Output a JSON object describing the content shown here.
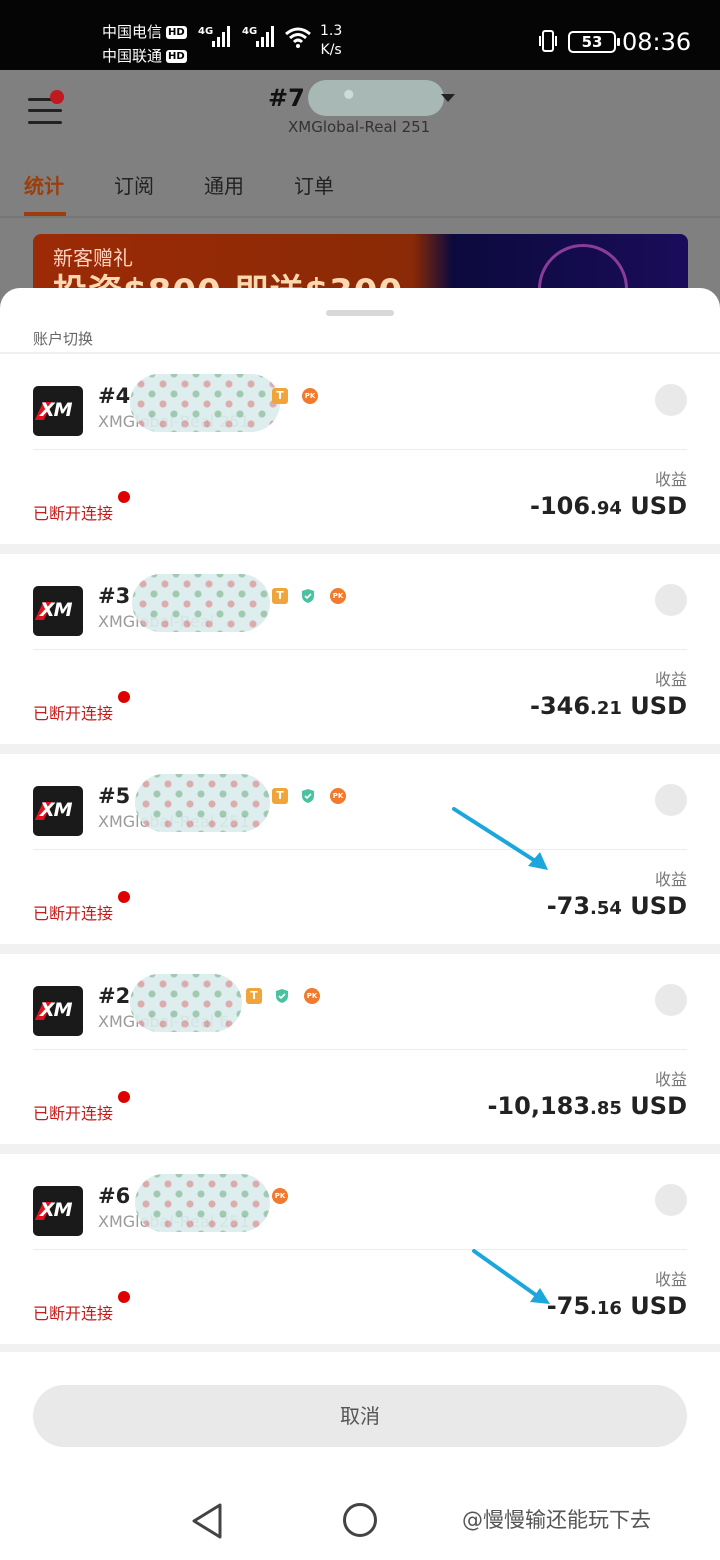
{
  "status_bar": {
    "carrier1": "中国电信",
    "carrier2": "中国联通",
    "hd_label": "HD",
    "net1": "4G",
    "net2": "4G",
    "speed_value": "1.3",
    "speed_unit": "K/s",
    "battery": "53",
    "time": "08:36"
  },
  "header": {
    "account_number": "#7",
    "server": "XMGlobal-Real 251"
  },
  "tabs": [
    "统计",
    "订阅",
    "通用",
    "订单"
  ],
  "banner": {
    "title": "新客赠礼",
    "headline": "投资$800 即送$300"
  },
  "sheet": {
    "title": "账户切换",
    "profit_label": "收益",
    "status_label": "已断开连接",
    "cancel_label": "取消"
  },
  "accounts": [
    {
      "number": "#4",
      "server": "XMGlobal-Real 251",
      "profit_int": "-106",
      "profit_dec": ".94",
      "currency": "USD",
      "badges": [
        "T",
        "PK"
      ]
    },
    {
      "number": "#3",
      "server": "XMGlobal-Real",
      "profit_int": "-346",
      "profit_dec": ".21",
      "currency": "USD",
      "badges": [
        "T",
        "shield",
        "PK"
      ]
    },
    {
      "number": "#5",
      "server": "XMGlobal-Real 251",
      "profit_int": "-73",
      "profit_dec": ".54",
      "currency": "USD",
      "badges": [
        "T",
        "shield",
        "PK"
      ]
    },
    {
      "number": "#2",
      "server": "XMGlobal-Real 6",
      "profit_int": "-10,183",
      "profit_dec": ".85",
      "currency": "USD",
      "badges": [
        "T",
        "shield",
        "PK"
      ]
    },
    {
      "number": "#6",
      "server": "XMGlobal-Real 251",
      "profit_int": "-75",
      "profit_dec": ".16",
      "currency": "USD",
      "badges": [
        "PK"
      ]
    }
  ],
  "logo_text": "XM",
  "watermark": "@慢慢输还能玩下去",
  "colors": {
    "accent": "#9c3e0b",
    "disconnected": "#c41a1a",
    "annotation_arrow": "#1ba7dc"
  }
}
